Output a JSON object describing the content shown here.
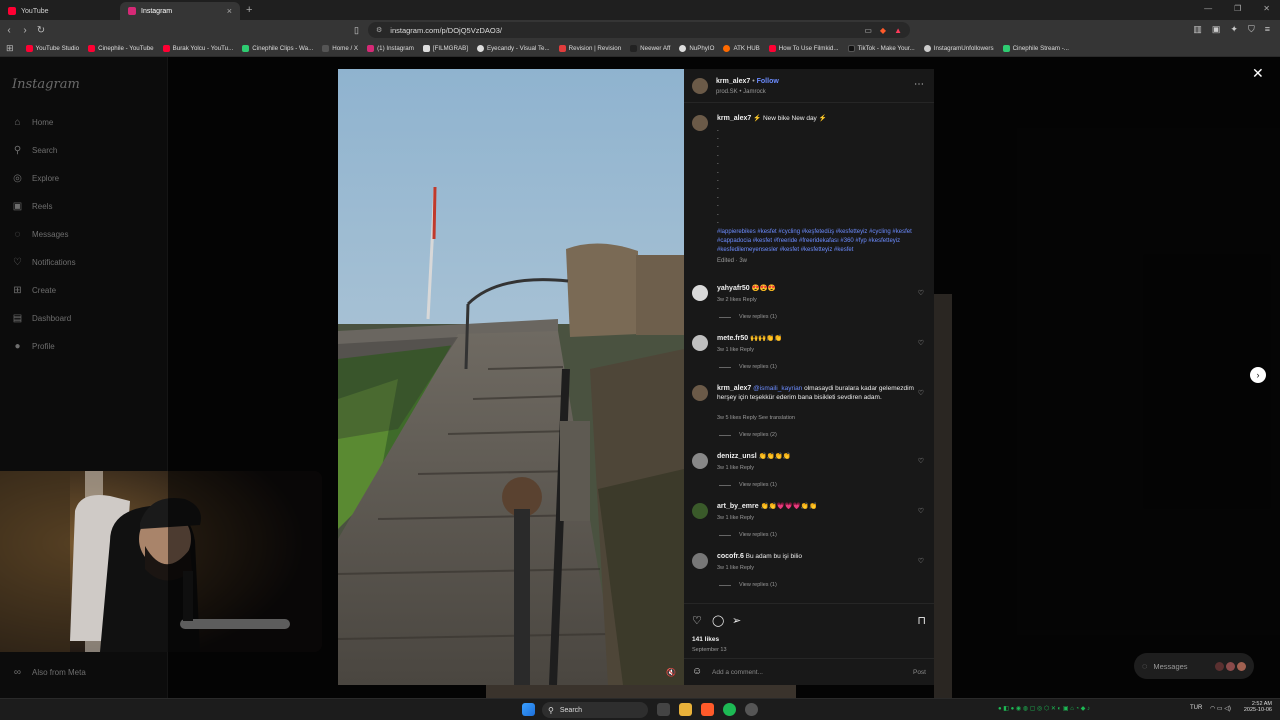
{
  "browser": {
    "tabs": [
      {
        "title": "YouTube",
        "color": "#ff0033",
        "active": false
      },
      {
        "title": "Instagram",
        "color": "#d62976",
        "active": true
      }
    ],
    "url": "instagram.com/p/DOjQ5VzDAO3/",
    "bookmarks": [
      {
        "label": "YouTube Studio",
        "color": "#ff0033"
      },
      {
        "label": "Cinephile - YouTube",
        "color": "#ff0033"
      },
      {
        "label": "Burak Yolcu - YouTu...",
        "color": "#ff0033"
      },
      {
        "label": "Cinephile Clips - Wa...",
        "color": "#2ecc71"
      },
      {
        "label": "Home / X",
        "color": "#000000"
      },
      {
        "label": "(1) Instagram",
        "color": "#d62976"
      },
      {
        "label": "[FILMGRAB]",
        "color": "#ffffff"
      },
      {
        "label": "Eyecandy - Visual Te...",
        "color": "#ffffff"
      },
      {
        "label": "Revision | Revision",
        "color": "#e23c3c"
      },
      {
        "label": "Neewer Aff",
        "color": "#333333"
      },
      {
        "label": "NuPhyIO",
        "color": "#ffffff"
      },
      {
        "label": "ATK HUB",
        "color": "#ff6a00"
      },
      {
        "label": "How To Use Filmkid...",
        "color": "#ff0033"
      },
      {
        "label": "TikTok - Make Your...",
        "color": "#111111"
      },
      {
        "label": "InstagramUnfollowers",
        "color": "#cccccc"
      },
      {
        "label": "Cinephile Stream -...",
        "color": "#2ecc71"
      }
    ]
  },
  "sidebar": {
    "logo": "Instagram",
    "items": [
      {
        "label": "Home",
        "icon": "⌂"
      },
      {
        "label": "Search",
        "icon": "⚲"
      },
      {
        "label": "Explore",
        "icon": "◎"
      },
      {
        "label": "Reels",
        "icon": "▣"
      },
      {
        "label": "Messages",
        "icon": "◌"
      },
      {
        "label": "Notifications",
        "icon": "♡"
      },
      {
        "label": "Create",
        "icon": "⊞"
      },
      {
        "label": "Dashboard",
        "icon": "▤"
      },
      {
        "label": "Profile",
        "icon": "●"
      }
    ],
    "meta": "Also from Meta"
  },
  "post": {
    "username": "krm_alex7",
    "follow": "Follow",
    "audio": "prod.SK • Jamrock",
    "caption_user": "krm_alex7",
    "caption": "⚡ New bike New day ⚡",
    "hashtags": "#lappierebikes #kesfet #cycling #keşfetedüş #kesfetteyiz #cycling #kesfet #cappadocia #kesfet #freeride #freeridekafası #360 #fyp #kesfetteyiz #kesfedilemeyensesler #kesfet #kesfetteyiz #kesfet",
    "edited": "Edited · 3w",
    "likes": "141 likes",
    "date": "September 13",
    "add_comment": "Add a comment...",
    "post_btn": "Post"
  },
  "comments": [
    {
      "user": "yahyafr50",
      "text": "😍😍😍",
      "meta": "3w   2 likes   Reply",
      "replies": "View replies (1)",
      "avatar": "#d9d9d9"
    },
    {
      "user": "mete.fr50",
      "text": "🙌🙌👏👏",
      "meta": "3w   1 like   Reply",
      "replies": "View replies (1)",
      "avatar": "#bfbfbf"
    },
    {
      "user": "krm_alex7",
      "mention": "@ismaili_kayrian",
      "text": " olmasaydi buralara kadar gelemezdim herşey için teşekkür ederim bana bisikleti sevdiren adam.",
      "meta": "3w   5 likes   Reply   See translation",
      "replies": "View replies (2)",
      "avatar": "#6b5a48"
    },
    {
      "user": "denizz_unsl",
      "text": "👏👏👏👏",
      "meta": "3w   1 like   Reply",
      "replies": "View replies (1)",
      "avatar": "#888888"
    },
    {
      "user": "art_by_emre",
      "text": "👏👏💗💗💗👏👏",
      "meta": "3w   1 like   Reply",
      "replies": "View replies (1)",
      "avatar": "#3a5a2a"
    },
    {
      "user": "cocofr.6",
      "text": "Bu adam bu işi bilio",
      "meta": "3w   1 like   Reply",
      "replies": "View replies (1)",
      "avatar": "#777777"
    }
  ],
  "floating": {
    "messages": "Messages"
  },
  "taskbar": {
    "search": "Search",
    "lang": "TUR",
    "time": "2:52 AM",
    "date": "2025-10-06"
  },
  "colors": {
    "accent": "#6c8cff",
    "panel": "#181818"
  }
}
